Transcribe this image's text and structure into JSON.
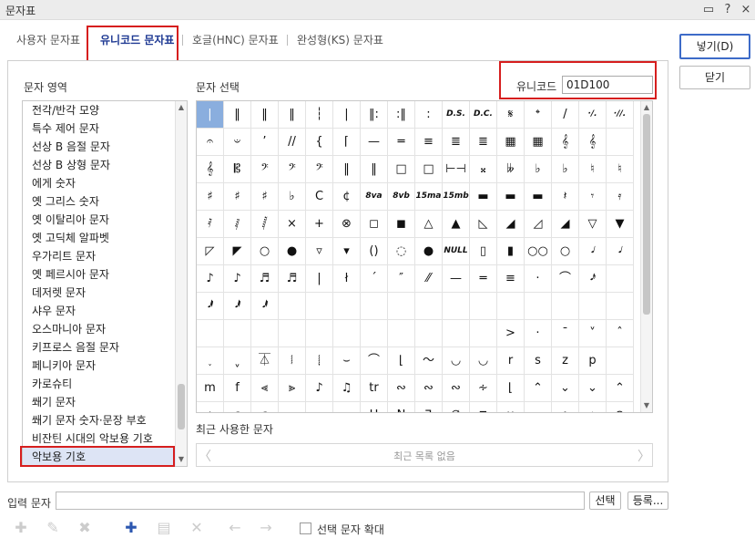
{
  "window": {
    "title": "문자표",
    "controls": [
      "▭",
      "?",
      "×"
    ]
  },
  "tabs": [
    "사용자 문자표",
    "유니코드 문자표",
    "호글(HNC) 문자표",
    "완성형(KS) 문자표"
  ],
  "labels": {
    "area": "문자 영역",
    "select": "문자 선택",
    "unicode": "유니코드",
    "recent": "최근 사용한 문자",
    "recent_empty": "최근 목록 없음",
    "input": "입력 문자",
    "expand": "선택 문자 확대"
  },
  "unicode_value": "01D100",
  "buttons": {
    "insert": "넣기(D)",
    "close": "닫기",
    "select": "선택",
    "register": "등록..."
  },
  "areas": [
    "전각/반각 모양",
    "특수 제어 문자",
    "선상 B 음절 문자",
    "선상 B 상형 문자",
    "에게 숫자",
    "옛 그리스 숫자",
    "옛 이탈리아 문자",
    "옛 고딕체 알파벳",
    "우가리트 문자",
    "옛 페르시아 문자",
    "데저렛 문자",
    "샤우 문자",
    "오스마니아 문자",
    "키프로스 음절 문자",
    "페니키아 문자",
    "카로슈티",
    "쐐기 문자",
    "쐐기 문자 숫자·문장 부호",
    "비잔틴 시대의 악보용 기호",
    "악보용 기호"
  ],
  "symbols": [
    [
      "|",
      "‖",
      "‖",
      "‖",
      "┆",
      "|",
      "‖:",
      ":‖",
      ":",
      "D.S.",
      "D.C.",
      "𝄋",
      "𝄌",
      "/",
      "·/.",
      "·//."
    ],
    [
      "𝄐",
      "𝄑",
      "’",
      "//",
      "{",
      "⌈",
      "—",
      "═",
      "≡",
      "≣",
      "≣",
      "▦",
      "▦",
      "𝄞",
      "𝄞",
      ""
    ],
    [
      "𝄞",
      "𝄡",
      "𝄢",
      "𝄢",
      "𝄢",
      "‖",
      "‖",
      "□",
      "□",
      "⊢⊣",
      "𝄪",
      "𝄫",
      "♭",
      "♭",
      "♮",
      "♮"
    ],
    [
      "♯",
      "♯",
      "♯",
      "♭",
      "C",
      "¢",
      "8va",
      "8vb",
      "15ma",
      "15mb",
      "▬",
      "▬",
      "▬",
      "𝄽",
      "𝄾",
      "𝄿"
    ],
    [
      "𝅀",
      "𝅁",
      "𝅂",
      "×",
      "+",
      "⊗",
      "◻",
      "◼",
      "△",
      "▲",
      "◺",
      "◢",
      "◿",
      "◢",
      "▽",
      "▼"
    ],
    [
      "◸",
      "◤",
      "○",
      "●",
      "▿",
      "▾",
      "()",
      "◌",
      "●",
      "NULL",
      "▯",
      "▮",
      "○○",
      "○",
      "𝅗𝅥",
      "𝅘𝅥"
    ],
    [
      "♪",
      "♪",
      "♬",
      "♬",
      "|",
      "ł",
      "ˊ",
      "″",
      "⁄⁄",
      "—",
      "═",
      "≡",
      "·",
      "⌒",
      "𝅘𝅥𝅯",
      ""
    ],
    [
      "𝅘𝅥𝅱",
      "𝅘𝅥𝅱",
      "𝅘𝅥𝅱",
      "",
      "",
      "",
      "",
      "",
      "",
      "",
      "",
      "",
      "",
      "",
      "",
      ""
    ],
    [
      "",
      "",
      "",
      "",
      "",
      "",
      "",
      "",
      "",
      "",
      "",
      ">",
      "·",
      "ˉ",
      "˅",
      "ˆ"
    ],
    [
      "˯",
      "ˬ",
      "⏄",
      "𝆃",
      "𝆄",
      "⌣",
      "⌒",
      "⌊",
      "〜",
      "◡",
      "◡",
      "r",
      "s",
      "z",
      "p",
      ""
    ],
    [
      "m",
      "f",
      "⪡",
      "⪢",
      "♪",
      "♫",
      "tr",
      "∾",
      "∾",
      "∾",
      "∻",
      "⌊",
      "⌃",
      "⌄",
      "⌄",
      "⌃"
    ],
    [
      "ı",
      "ᴄ",
      "c",
      "⌢",
      "⌣",
      "⌢",
      "H",
      "N",
      "ᒣ",
      "∅",
      "⊓",
      "∨",
      "∘",
      "ᴧ",
      "⌖",
      "⊛"
    ]
  ]
}
